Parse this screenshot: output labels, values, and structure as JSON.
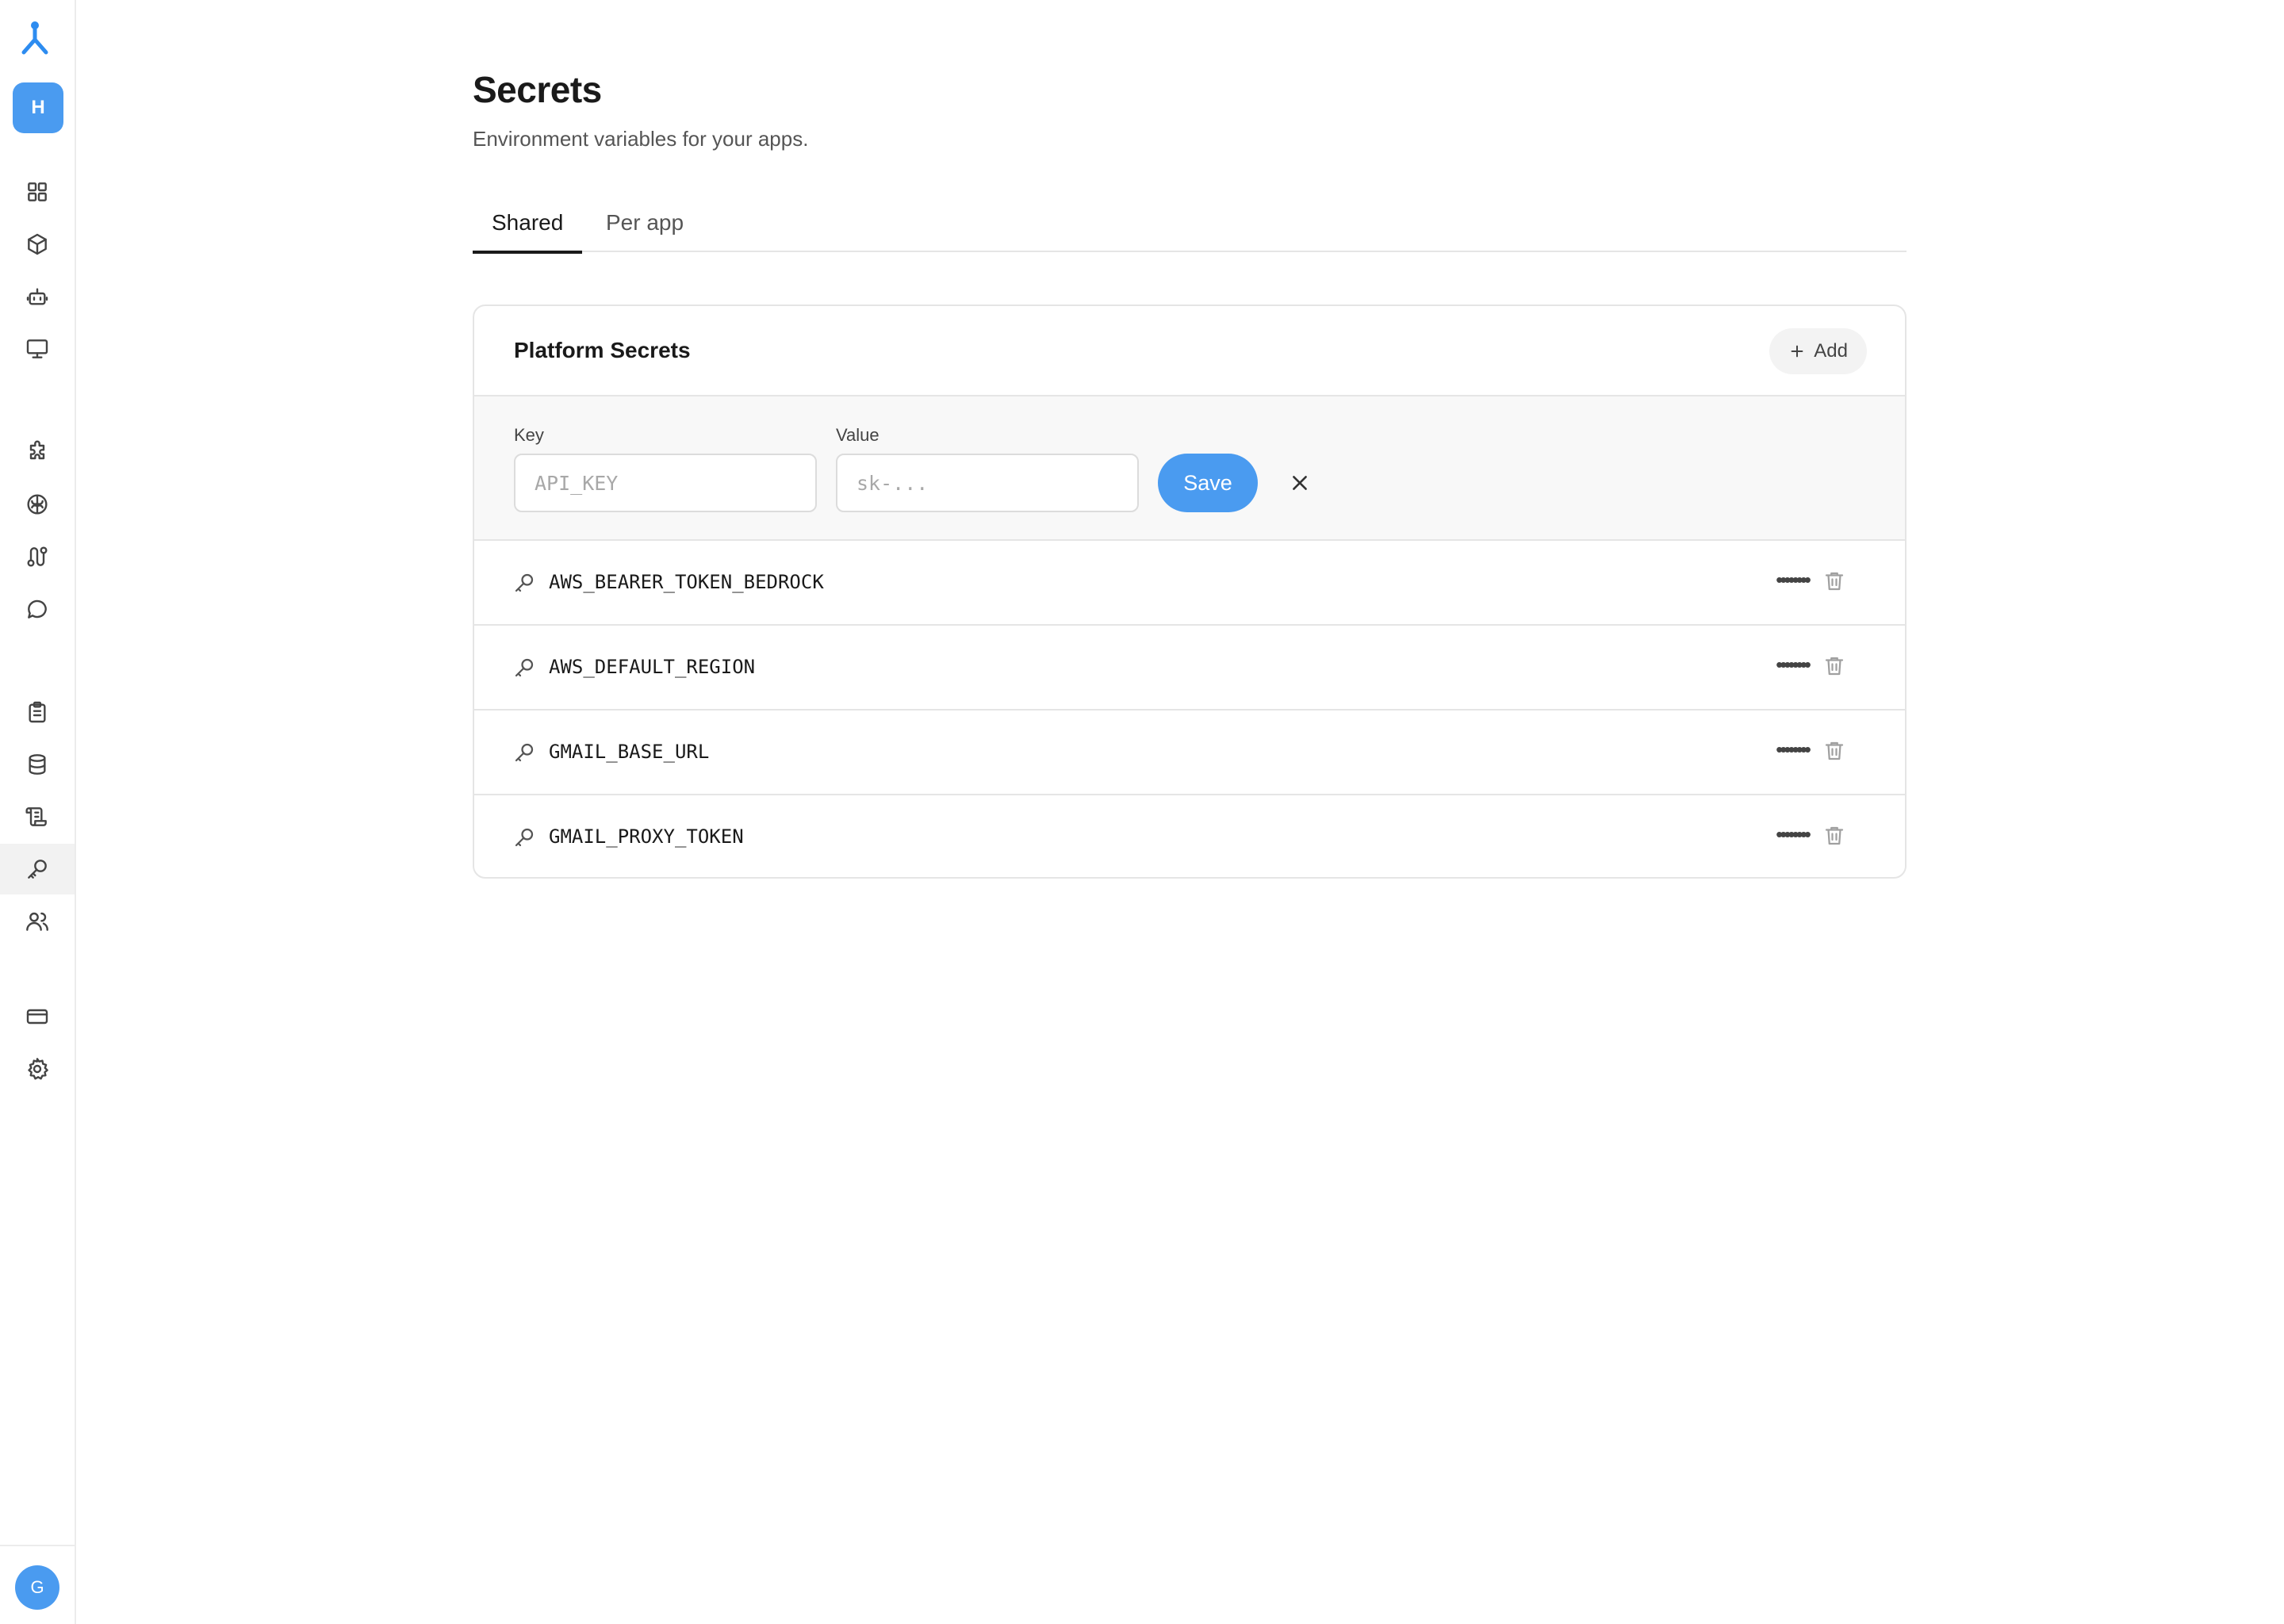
{
  "sidebar": {
    "logo_icon": "fork-logo-icon",
    "workspace_initial": "H",
    "items": [
      {
        "name": "dashboard",
        "icon": "grid-icon"
      },
      {
        "name": "apps",
        "icon": "cube-icon"
      },
      {
        "name": "agents",
        "icon": "bot-icon"
      },
      {
        "name": "desktops",
        "icon": "monitor-icon"
      },
      {
        "name": "integrations",
        "icon": "puzzle-icon"
      },
      {
        "name": "models",
        "icon": "brain-icon"
      },
      {
        "name": "workflows",
        "icon": "route-icon"
      },
      {
        "name": "chat",
        "icon": "chat-bubble-icon"
      },
      {
        "name": "tasks",
        "icon": "clipboard-icon"
      },
      {
        "name": "database",
        "icon": "database-icon"
      },
      {
        "name": "logs",
        "icon": "scroll-icon"
      },
      {
        "name": "secrets",
        "icon": "key-icon",
        "active": true
      },
      {
        "name": "team",
        "icon": "users-icon"
      },
      {
        "name": "billing",
        "icon": "credit-card-icon"
      },
      {
        "name": "settings",
        "icon": "gear-icon"
      }
    ],
    "user_initial": "G"
  },
  "page": {
    "title": "Secrets",
    "subtitle": "Environment variables for your apps."
  },
  "tabs": [
    {
      "label": "Shared",
      "active": true
    },
    {
      "label": "Per app",
      "active": false
    }
  ],
  "card": {
    "title": "Platform Secrets",
    "add_label": "Add",
    "form": {
      "key_label": "Key",
      "key_placeholder": "API_KEY",
      "key_value": "",
      "value_label": "Value",
      "value_placeholder": "sk-...",
      "value_value": "",
      "save_label": "Save"
    },
    "secrets": [
      {
        "name": "AWS_BEARER_TOKEN_BEDROCK",
        "masked": "••••••••"
      },
      {
        "name": "AWS_DEFAULT_REGION",
        "masked": "••••••••"
      },
      {
        "name": "GMAIL_BASE_URL",
        "masked": "••••••••"
      },
      {
        "name": "GMAIL_PROXY_TOKEN",
        "masked": "••••••••"
      }
    ]
  },
  "colors": {
    "accent": "#4a9bf0",
    "border": "#e5e5e5",
    "text": "#1a1a1a"
  }
}
